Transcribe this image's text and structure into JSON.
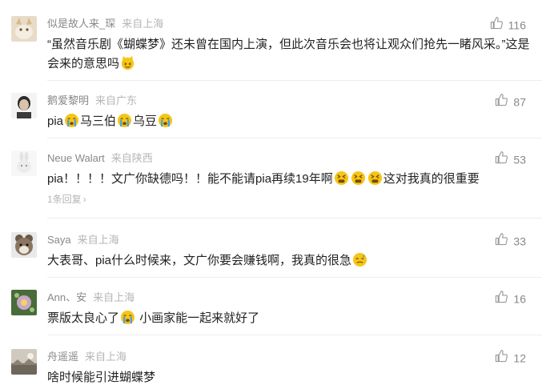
{
  "comments": [
    {
      "username": "似是故人来_琛",
      "location": "来自上海",
      "likes": "116",
      "avatar_icon": "cat-photo-avatar",
      "text_parts": [
        "“虽然音乐剧《蝴蝶梦》还未曾在国内上演，但此次音乐会也将让观众们抢先一睹风采。”这是会来的意思吗"
      ]
    },
    {
      "username": "鹅爱黎明",
      "location": "来自广东",
      "likes": "87",
      "avatar_icon": "person-photo-avatar",
      "text_parts": [
        "pia",
        "马三伯",
        "乌豆"
      ]
    },
    {
      "username": "Neue Walart",
      "location": "来自陕西",
      "likes": "53",
      "avatar_icon": "bunny-photo-avatar",
      "text_parts": [
        "pia！！！！文广你缺德吗！！能不能请pia再续19年啊",
        "这对我真的很重要"
      ],
      "reply_text": "1条回复"
    },
    {
      "username": "Saya",
      "location": "来自上海",
      "likes": "33",
      "avatar_icon": "chipmunk-photo-avatar",
      "text_parts": [
        "大表哥、pia什么时候来，文广你要会赚钱啊，我真的很急"
      ]
    },
    {
      "username": "Ann、安",
      "location": "来自上海",
      "likes": "16",
      "avatar_icon": "flower-photo-avatar",
      "text_parts": [
        "票版太良心了",
        " 小画家能一起来就好了"
      ]
    },
    {
      "username": "舟遥遥",
      "location": "来自上海",
      "likes": "12",
      "avatar_icon": "landscape-photo-avatar",
      "text_parts": [
        "啥时候能引进蝴蝶梦"
      ]
    }
  ],
  "colors": {
    "username": "#888888",
    "location": "#b5b5b5",
    "text": "#222222",
    "divider": "#eeeeee",
    "emoji": "#f5c518"
  }
}
